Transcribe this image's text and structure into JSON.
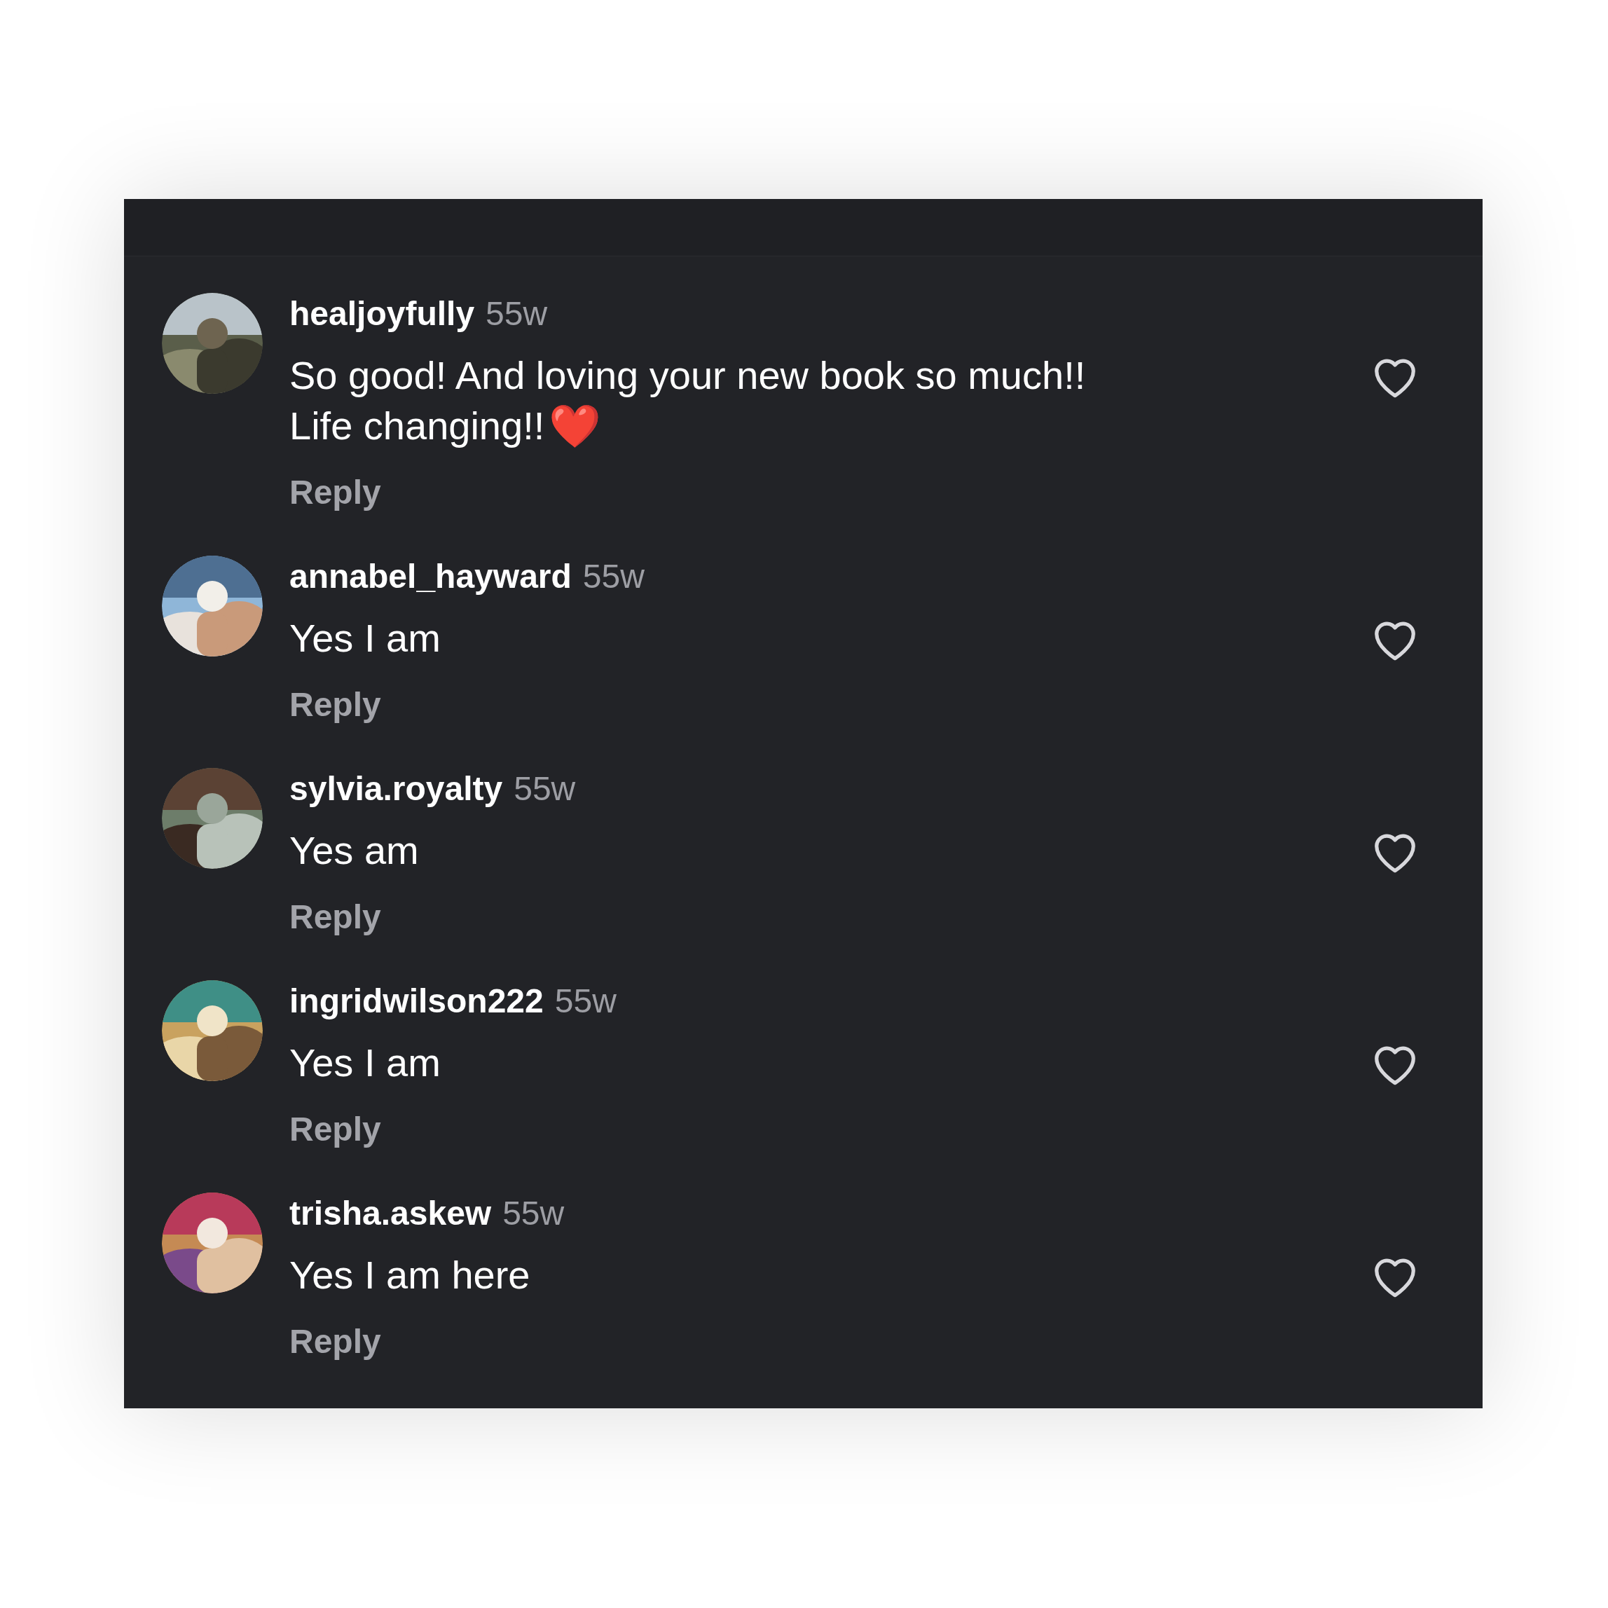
{
  "comments": [
    {
      "username": "healjoyfully",
      "time": "55w",
      "lines": [
        "So good! And loving your new book so much!!",
        "Life changing!!"
      ],
      "emoji": "❤️",
      "reply": "Reply",
      "liked": false
    },
    {
      "username": "annabel_hayward",
      "time": "55w",
      "lines": [
        "Yes I am"
      ],
      "reply": "Reply",
      "liked": false
    },
    {
      "username": "sylvia.royalty",
      "time": "55w",
      "lines": [
        "Yes am"
      ],
      "reply": "Reply",
      "liked": false
    },
    {
      "username": "ingridwilson222",
      "time": "55w",
      "lines": [
        "Yes I am"
      ],
      "reply": "Reply",
      "liked": false
    },
    {
      "username": "trisha.askew",
      "time": "55w",
      "lines": [
        "Yes I am here"
      ],
      "reply": "Reply",
      "liked": false
    }
  ]
}
